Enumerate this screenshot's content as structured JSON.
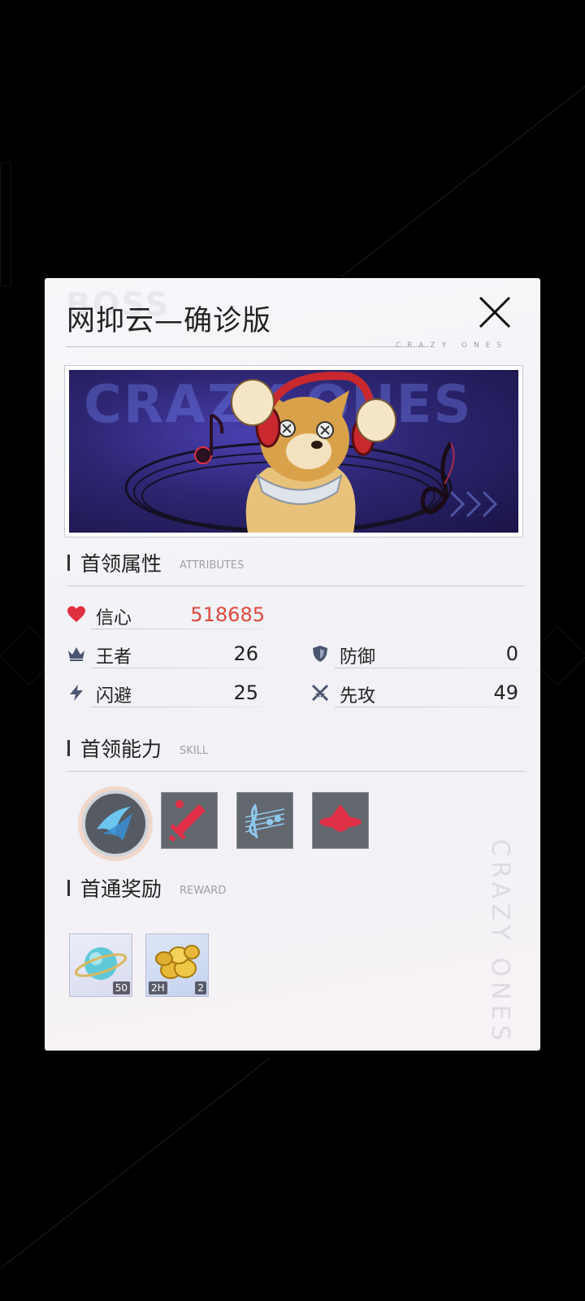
{
  "boss": {
    "ghost_label": "BOSS",
    "title": "网抑云—确诊版",
    "brand_small": "CRAZY ONES",
    "banner_ghost_text": "CRAZY ONES"
  },
  "sections": {
    "attributes": {
      "title": "首领属性",
      "en": "ATTRIBUTES"
    },
    "skill": {
      "title": "首领能力",
      "en": "SKILL"
    },
    "reward": {
      "title": "首通奖励",
      "en": "REWARD"
    }
  },
  "stats": {
    "hp": {
      "label": "信心",
      "value": "518685",
      "icon": "heart-icon"
    },
    "king": {
      "label": "王者",
      "value": "26",
      "icon": "crown-icon"
    },
    "defense": {
      "label": "防御",
      "value": "0",
      "icon": "shield-icon"
    },
    "dodge": {
      "label": "闪避",
      "value": "25",
      "icon": "lightning-icon"
    },
    "initiative": {
      "label": "先攻",
      "value": "49",
      "icon": "crossed-swords-icon"
    }
  },
  "skills": [
    "crescent-slash-icon",
    "sword-icon",
    "music-notes-icon",
    "ufo-icon"
  ],
  "rewards": [
    {
      "icon": "planet-orb-icon",
      "count": "50"
    },
    {
      "icon": "gold-coins-icon",
      "duration": "2H",
      "count": "2"
    }
  ],
  "side_text": "CRAZY ONES",
  "colors": {
    "hp_value": "#e0483c",
    "panel_bg": "#f5f5f8",
    "banner_bg": "#2d2672"
  }
}
